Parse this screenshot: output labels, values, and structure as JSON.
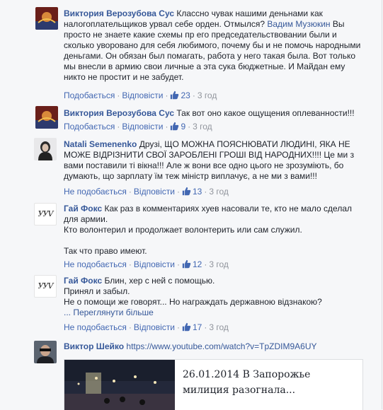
{
  "comments": [
    {
      "author": "Виктория Верозубова Сус",
      "text_before": " Классно чувак нашими деньнами как налогоплательщиков урвал себе орден. Отмылся? ",
      "mention": "Вадим Музюкин",
      "text_after": " Вы просто не знаете какие схемы пр его председательствовании были и сколько уворовано для себя любимого, почему бы и не помочь народными деньгами. Он обязан был помагать, работа у него такая была. Вот только мы внесли в армию свои личные а эта сука бюджетные. И Майдан ему никто не простит и не забудет.",
      "like_label": "Подобається",
      "reply_label": "Відповісти",
      "likes": "23",
      "time": "3 год"
    },
    {
      "author": "Виктория Верозубова Сус",
      "text": " Так вот оно какое ощущения оплеванности!!!",
      "like_label": "Подобається",
      "reply_label": "Відповісти",
      "likes": "9",
      "time": "3 год"
    },
    {
      "author": "Natali Semenenko",
      "text": " Друзі, ЩО МОЖНА ПОЯСНЮВАТИ ЛЮДИНІ, ЯКА НЕ МОЖЕ ВІДРІЗНИТИ СВОЇ ЗАРОБЛЕНІ ГРОШІ ВІД НАРОДНИХ!!!! Це ми з вами поставили ті вікна!!! Але ж вони все одно цього не зрозуміють, бо думають, що зарплату їм теж міністр виплачує, а не ми з вами!!!",
      "like_label": "Не подобається",
      "reply_label": "Відповісти",
      "likes": "13",
      "time": "3 год"
    },
    {
      "author": "Гай Фокс",
      "line1": " Как раз в комментариях хуев насовали те, кто не мало сделал для армии.",
      "line2": "Кто волонтерил и продолжает волонтерить или сам служил.",
      "line3": "Так что право имеют.",
      "avatar_text": "УУV",
      "like_label": "Не подобається",
      "reply_label": "Відповісти",
      "likes": "12",
      "time": "3 год"
    },
    {
      "author": "Гай Фокс",
      "line1": " Блин, хер с ней с помощью.",
      "line2": "Принял и забыл.",
      "line3": "Не о помощи же говорят... Но награждать державною відзнакою?",
      "more": "... Переглянути більше",
      "avatar_text": "УУV",
      "like_label": "Не подобається",
      "reply_label": "Відповісти",
      "likes": "17",
      "time": "3 год"
    },
    {
      "author": "Виктор Шейко",
      "link": "https://www.youtube.com/watch?v=TpZDIM9A6UY",
      "video_title": "26.01.2014 В Запорожье милиция разогнала..."
    }
  ],
  "colors": {
    "link": "#365899",
    "meta": "#90949c",
    "action": "#4267b2"
  }
}
